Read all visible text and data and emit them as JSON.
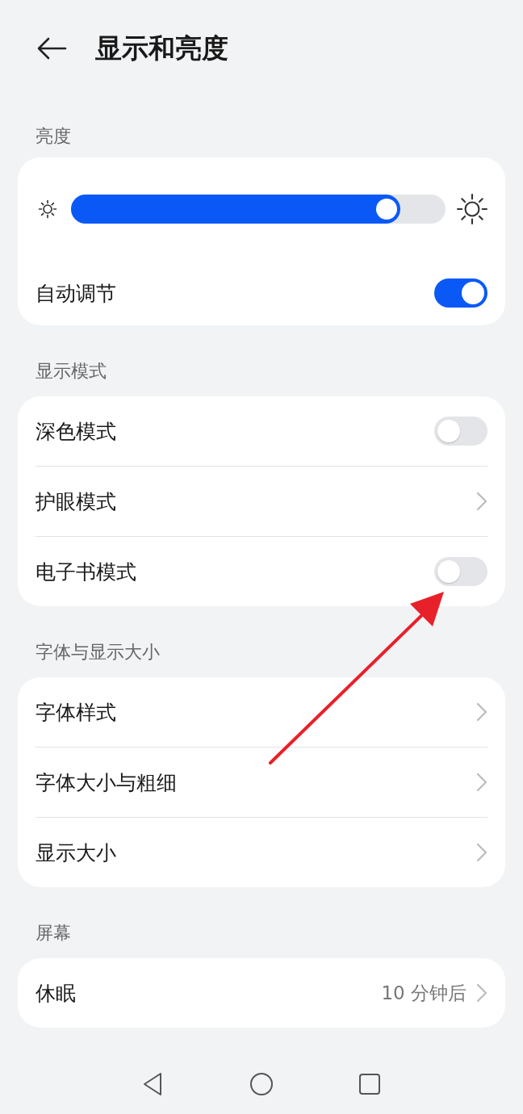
{
  "header": {
    "title": "显示和亮度"
  },
  "sections": [
    {
      "title": "亮度",
      "items": [
        {
          "kind": "slider",
          "level": 0.88
        },
        {
          "kind": "toggle",
          "label": "自动调节",
          "on": true
        }
      ]
    },
    {
      "title": "显示模式",
      "items": [
        {
          "kind": "toggle",
          "label": "深色模式",
          "on": false
        },
        {
          "kind": "link",
          "label": "护眼模式"
        },
        {
          "kind": "toggle",
          "label": "电子书模式",
          "on": false
        }
      ]
    },
    {
      "title": "字体与显示大小",
      "items": [
        {
          "kind": "link",
          "label": "字体样式"
        },
        {
          "kind": "link",
          "label": "字体大小与粗细"
        },
        {
          "kind": "link",
          "label": "显示大小"
        }
      ]
    },
    {
      "title": "屏幕",
      "items": [
        {
          "kind": "link",
          "label": "休眠",
          "value": "10 分钟后"
        }
      ]
    }
  ]
}
